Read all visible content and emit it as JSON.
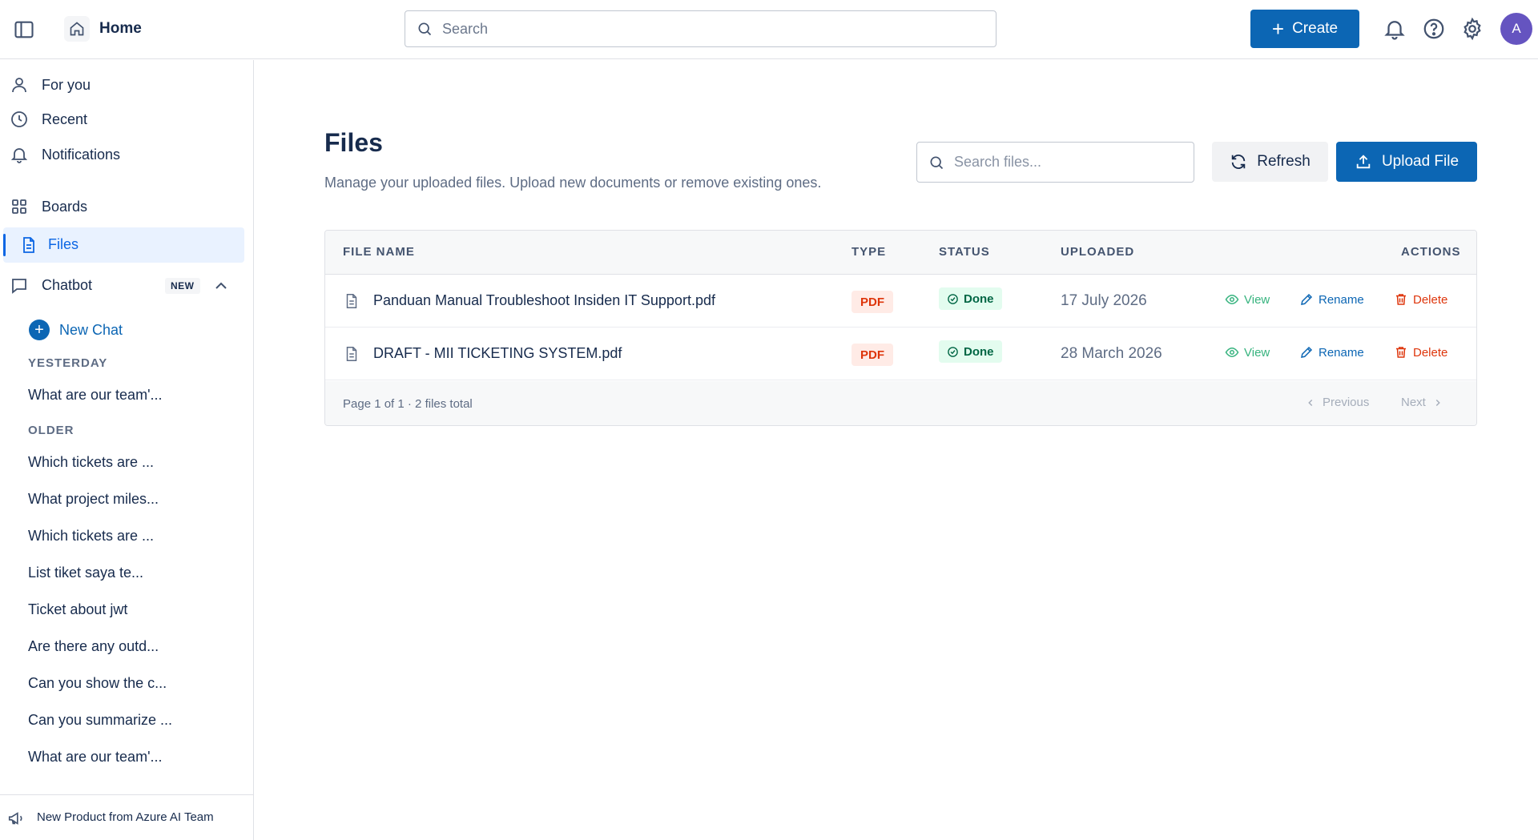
{
  "topbar": {
    "home_label": "Home",
    "search_placeholder": "Search",
    "create_label": "Create",
    "avatar_initial": "A"
  },
  "sidebar": {
    "nav": [
      {
        "label": "For you",
        "icon": "person-icon"
      },
      {
        "label": "Recent",
        "icon": "clock-icon"
      },
      {
        "label": "Notifications",
        "icon": "bell-icon"
      },
      {
        "label": "Boards",
        "icon": "grid-icon"
      },
      {
        "label": "Files",
        "icon": "document-icon",
        "active": true
      }
    ],
    "chatbot": {
      "label": "Chatbot",
      "badge": "NEW"
    },
    "new_chat_label": "New Chat",
    "yesterday_label": "YESTERDAY",
    "yesterday_chats": [
      "What are our team'..."
    ],
    "older_label": "OLDER",
    "older_chats": [
      "Which tickets are ...",
      "What project miles...",
      "Which tickets are ...",
      "List tiket saya te...",
      "Ticket about jwt",
      "Are there any outd...",
      "Can you show the c...",
      "Can you summarize ...",
      "What are our team'..."
    ],
    "footer_label": "New Product from Azure AI Team"
  },
  "main": {
    "title": "Files",
    "description": "Manage your uploaded files. Upload new documents or remove existing ones.",
    "search_placeholder": "Search files...",
    "refresh_label": "Refresh",
    "upload_label": "Upload File",
    "table": {
      "headers": {
        "file_name": "FILE NAME",
        "type": "TYPE",
        "status": "STATUS",
        "uploaded": "UPLOADED",
        "actions": "ACTIONS"
      },
      "rows": [
        {
          "file_name": "Panduan Manual Troubleshoot Insiden IT Support.pdf",
          "type": "PDF",
          "status": "Done",
          "uploaded": "17 July 2026"
        },
        {
          "file_name": "DRAFT - MII TICKETING SYSTEM.pdf",
          "type": "PDF",
          "status": "Done",
          "uploaded": "28 March 2026"
        }
      ],
      "actions": {
        "view": "View",
        "rename": "Rename",
        "delete": "Delete"
      },
      "footer_info": "Page 1 of 1 · 2 files total",
      "prev_label": "Previous",
      "next_label": "Next"
    }
  },
  "colors": {
    "primary": "#0c66b4",
    "active_bg": "#e9f2ff",
    "danger": "#de350b",
    "success": "#36b37e",
    "avatar": "#6554c0"
  }
}
